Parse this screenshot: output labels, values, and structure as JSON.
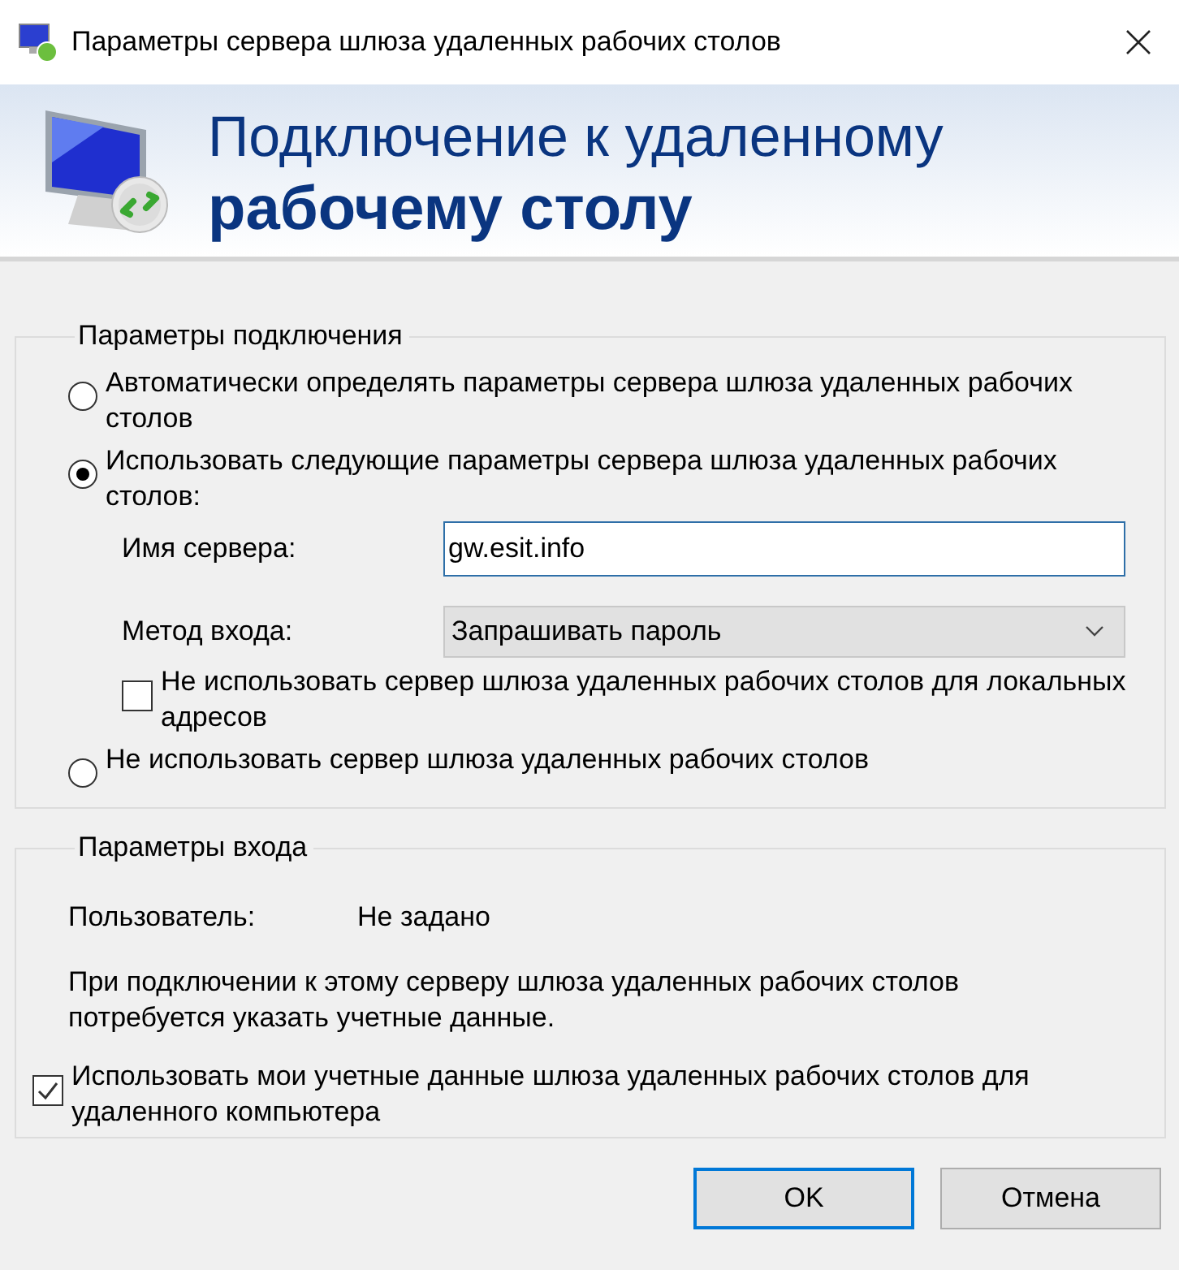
{
  "window": {
    "title": "Параметры сервера шлюза удаленных рабочих столов"
  },
  "banner": {
    "line1": "Подключение к удаленному",
    "line2": "рабочему столу"
  },
  "connection_group": {
    "legend": "Параметры подключения",
    "items": [
      {
        "kind": "radio",
        "label": "Автоматически определять параметры сервера шлюза удаленных рабочих столов",
        "selected": false
      },
      {
        "kind": "radio",
        "label": "Использовать следующие параметры сервера шлюза удаленных рабочих столов:",
        "selected": true
      },
      {
        "kind": "field",
        "label": "Имя сервера:",
        "value": "gw.esit.info"
      },
      {
        "kind": "dropdown",
        "label": "Метод входа:",
        "value": "Запрашивать пароль"
      },
      {
        "kind": "checkbox",
        "label": "Не использовать сервер шлюза удаленных рабочих столов для локальных адресов",
        "checked": false
      },
      {
        "kind": "radio",
        "label": "Не использовать сервер шлюза удаленных рабочих столов",
        "selected": false
      }
    ]
  },
  "login_group": {
    "legend": "Параметры входа",
    "user_label": "Пользователь:",
    "user_value": "Не задано",
    "note": "При подключении к этому серверу шлюза удаленных рабочих столов потребуется указать учетные данные.",
    "checkbox": {
      "label": "Использовать мои учетные данные шлюза удаленных рабочих столов для удаленного компьютера",
      "checked": true
    }
  },
  "buttons": [
    {
      "label": "OK",
      "default": true
    },
    {
      "label": "Отмена",
      "default": false
    }
  ]
}
